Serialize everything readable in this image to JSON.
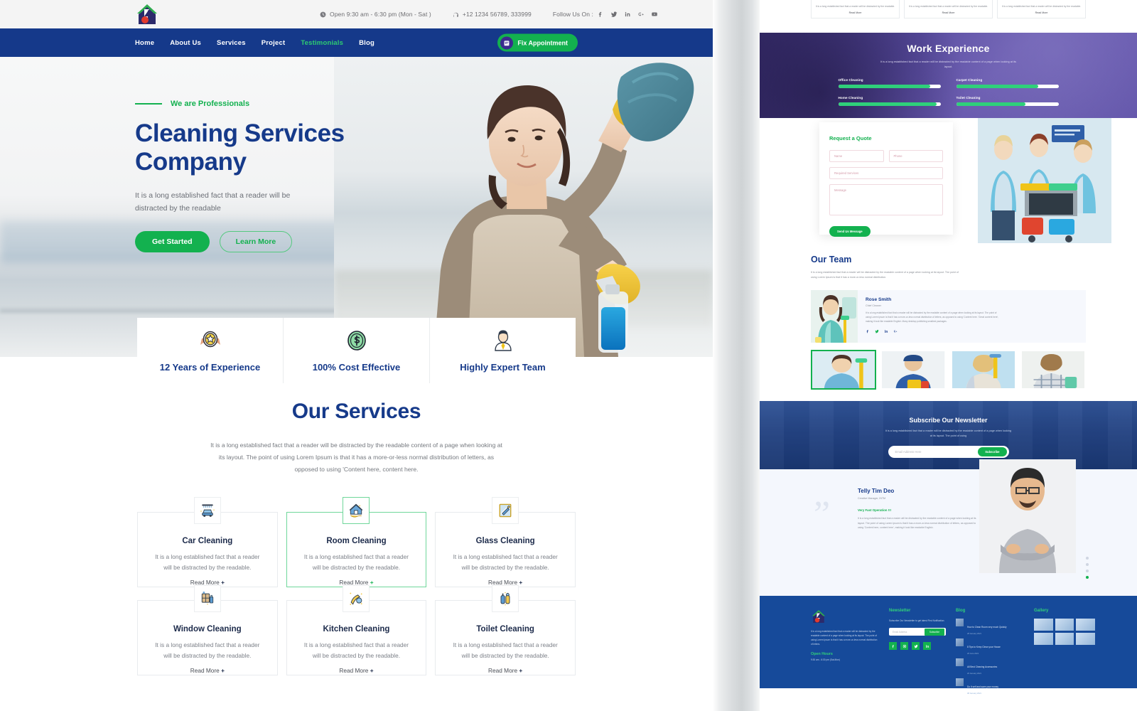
{
  "topbar": {
    "hours": "Open 9:30 am - 6:30 pm (Mon - Sat )",
    "phone": "+12 1234 56789, 333999",
    "follow_label": "Follow Us On :",
    "socials": [
      "facebook-icon",
      "twitter-icon",
      "linkedin-icon",
      "google-plus-icon",
      "youtube-icon"
    ]
  },
  "nav": {
    "items": [
      {
        "label": "Home",
        "active": false
      },
      {
        "label": "About Us",
        "active": false
      },
      {
        "label": "Services",
        "active": false
      },
      {
        "label": "Project",
        "active": false
      },
      {
        "label": "Testimonials",
        "active": true
      },
      {
        "label": "Blog",
        "active": false
      }
    ],
    "cta": "Fix Appointment"
  },
  "hero": {
    "eyebrow": "We are Professionals",
    "title_line1": "Cleaning Services",
    "title_line2": "Company",
    "subtitle": "It is a long established fact that a reader will be distracted by the readable",
    "btn_primary": "Get Started",
    "btn_secondary": "Learn More"
  },
  "features": [
    {
      "icon": "badge-star-icon",
      "label": "12 Years of Experience"
    },
    {
      "icon": "dollar-coin-icon",
      "label": "100% Cost Effective"
    },
    {
      "icon": "expert-person-icon",
      "label": "Highly Expert Team"
    }
  ],
  "services": {
    "title": "Our Services",
    "description": "It is a long established fact that a reader will be distracted by the readable content of a page when looking at its layout. The point of using Lorem Ipsum is that it has a more-or-less normal distribution of letters, as opposed to using 'Content here, content here.",
    "card_text": "It is a long established fact that a reader will be distracted by the readable.",
    "read_more": "Read More",
    "items": [
      {
        "name": "Car Cleaning",
        "icon": "car-wash-icon",
        "active": false
      },
      {
        "name": "Room Cleaning",
        "icon": "house-hand-icon",
        "active": true
      },
      {
        "name": "Glass Cleaning",
        "icon": "window-squeegee-icon",
        "active": false
      },
      {
        "name": "Window Cleaning",
        "icon": "window-spray-icon",
        "active": false
      },
      {
        "name": "Kitchen Cleaning",
        "icon": "kitchen-brush-icon",
        "active": false
      },
      {
        "name": "Toilet Cleaning",
        "icon": "toilet-bottles-icon",
        "active": false
      }
    ]
  },
  "work_experience": {
    "title": "Work Experience",
    "description": "It is a long established fact that a reader will be distracted by the readable content of a page when looking at its layout.",
    "skills": [
      {
        "label": "Office Cleaning",
        "percent": 90
      },
      {
        "label": "Carpet Cleaning",
        "percent": 80
      },
      {
        "label": "Home Cleaning",
        "percent": 96
      },
      {
        "label": "Toilet Cleaning",
        "percent": 68
      }
    ]
  },
  "quote_form": {
    "title": "Request a Quote",
    "name_placeholder": "Name",
    "phone_placeholder": "Phone",
    "service_placeholder": "Required Services",
    "message_placeholder": "Message",
    "submit": "Send Us Message"
  },
  "team": {
    "title": "Our Team",
    "description": "It is a long established fact that a reader will be distracted by the readable content of a page when looking at its layout. The point of using Lorem Ipsum is that it has a more-or-less normal distribution.",
    "member": {
      "name": "Rose Smith",
      "role": "Chief Cleaner",
      "bio": "It is a long established fact that a reader will be distracted by the readable content of a page when looking at its layout. The point of using Lorem Ipsum is that it has a more-or-less normal distribution of letters, as opposed to using 'Content here. 'Great content here', making it look like readable English. Many desktop publishing smallest packages.",
      "socials": [
        "facebook-icon",
        "twitter-icon",
        "linkedin-icon",
        "google-plus-icon"
      ]
    },
    "thumbnails": [
      {
        "name": "team-thumb-rose",
        "selected": true
      },
      {
        "name": "team-thumb-male",
        "selected": false
      },
      {
        "name": "team-thumb-blonde",
        "selected": false
      },
      {
        "name": "team-thumb-plaid",
        "selected": false
      }
    ]
  },
  "newsletter": {
    "title": "Subscribe Our Newsletter",
    "description": "It is a long established fact that a reader will be distracted by the readable content of a page when looking at its layout. The point of using",
    "placeholder": "Email Address Here",
    "button": "Subscribe"
  },
  "testimonial": {
    "name": "Telly Tim Deo",
    "role": "Creative Manager, INTM",
    "headline": "Very Fast Operation !!!",
    "body": "It is a long established fact that a reader will be distracted by the readable content of a page when looking at its layout. The point of using Lorem Ipsum is that it has a more-or-less normal distribution of letters, as opposed to using 'Content here, content here', making it look like readable English."
  },
  "footer": {
    "about": "It is a long established fact that a reader will be distracted by the readable content of a page when looking at its layout. The point of using Lorem Ipsum is that it has a more-or-less normal distribution of letters.",
    "open_hours_title": "Open Hours",
    "open_hours_text": "9:30 am - 6:30 pm (Sat-Mon)",
    "newsletter_title": "Newsletter",
    "newsletter_text": "Subscribe Our Newsletter to get latest First Notification.",
    "newsletter_placeholder": "Email Address",
    "newsletter_button": "Subscribe",
    "socials": [
      "facebook-icon",
      "instagram-icon",
      "twitter-icon",
      "linkedin-icon"
    ],
    "blog_title": "Blog",
    "blog_items": [
      {
        "title": "How to Clean Room very much Quickly",
        "date": "28 January 2021"
      },
      {
        "title": "8 Tips to Keep Clean your House",
        "date": "26 June 2021"
      },
      {
        "title": "All Best Cleaning Accessories",
        "date": "20 January 2021"
      },
      {
        "title": "Do It self and save your money",
        "date": "08 January 2021"
      }
    ],
    "gallery_title": "Gallery",
    "gallery_count": 6
  },
  "colors": {
    "navy": "#15398a",
    "green": "#13b14f",
    "purple": "#574a9e",
    "footer_blue": "#164a9a"
  }
}
